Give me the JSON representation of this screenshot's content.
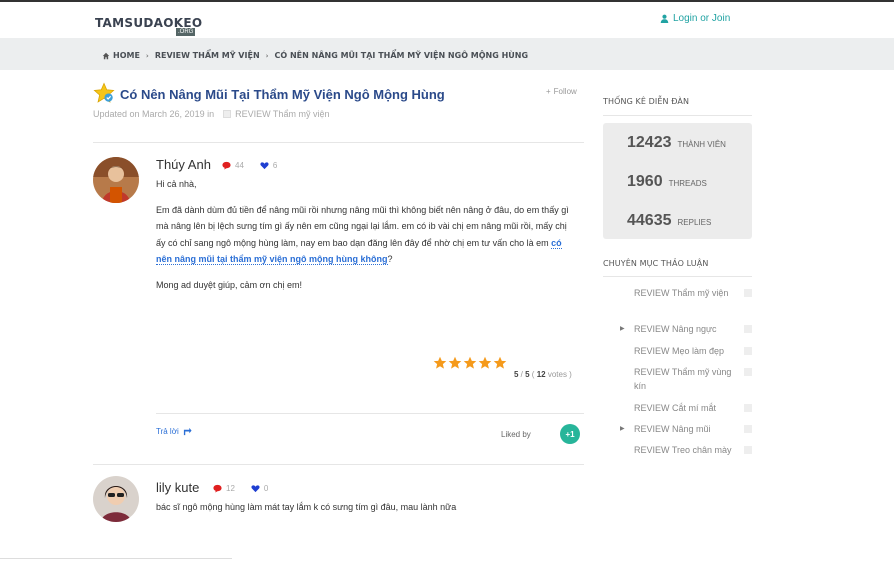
{
  "header": {
    "logo": "TAMSUDAOKEO",
    "logo_sub": ".ORG",
    "login": "Login or Join",
    "accent_color": "#21a3a3"
  },
  "breadcrumb": {
    "items": [
      "HOME",
      "REVIEW THẨM MỸ VIỆN",
      "CÓ NÊN NÂNG MŨI TẠI THẨM MỸ VIỆN NGÔ MỘNG HÙNG"
    ],
    "separator": "›"
  },
  "thread": {
    "title": "Có Nên Nâng Mũi Tại Thẩm Mỹ Viện Ngô Mộng Hùng",
    "follow": "Follow",
    "updated": "Updated on March 26, 2019 in",
    "category": "REVIEW Thẩm mỹ viện"
  },
  "posts": [
    {
      "author": "Thúy Anh",
      "comments": "44",
      "likes": "6",
      "paragraphs": {
        "p1": "Hi cả nhà,",
        "p2_before": "Em đã dành dùm đủ tiền để nâng mũi rồi nhưng nâng mũi thì không biết nên nâng ở đâu, do em thấy gì mà nâng lên bị lệch sưng tím gì ấy nên em cũng ngại lại lắm. em có ib vài chị em nâng mũi rồi, mấy chị ấy có chỉ sang ngô mộng hùng làm, nay em bao dạn đăng lên đây để nhờ chị em tư vấn cho là em ",
        "p2_link": "có nên nâng mũi tại thẩm mỹ viện ngô mộng hùng không",
        "p2_after": "?",
        "p3": "Mong ad duyệt giúp, cảm ơn chị em!"
      },
      "rating": {
        "stars": 5,
        "score": "5",
        "max": "5",
        "votes": "12",
        "votes_label": "votes"
      },
      "reply_label": "Trả lời",
      "liked_by": "Liked by",
      "plus_one": "+1"
    },
    {
      "author": "lily kute",
      "comments": "12",
      "likes": "0",
      "text": "bác sĩ ngô mộng hùng làm mát tay lắm k có sưng tím gì đâu, mau lành nữa"
    }
  ],
  "sidebar": {
    "stats_heading": "THỐNG KÊ DIỄN ĐÀN",
    "stats": [
      {
        "value": "12423",
        "label": "THÀNH VIÊN"
      },
      {
        "value": "1960",
        "label": "THREADS"
      },
      {
        "value": "44635",
        "label": "REPLIES"
      }
    ],
    "categories_heading": "CHUYÊN MỤC THẢO LUẬN",
    "categories": [
      {
        "label": "REVIEW Thẩm mỹ viện",
        "arrow": false
      },
      {
        "label": "REVIEW Nâng ngực",
        "arrow": true
      },
      {
        "label": "REVIEW Mẹo làm đẹp",
        "arrow": false
      },
      {
        "label": "REVIEW Thẩm mỹ vùng kín",
        "arrow": false
      },
      {
        "label": "REVIEW Cắt mí mắt",
        "arrow": false
      },
      {
        "label": "REVIEW Nâng mũi",
        "arrow": true
      },
      {
        "label": "REVIEW Treo chân mày",
        "arrow": false
      }
    ]
  },
  "colors": {
    "link_blue": "#2b6fd6",
    "title_blue": "#2b4a8a",
    "star_orange": "#f59a1b",
    "plus_green": "#27b59a",
    "comment_red": "#e02020",
    "heart_blue": "#1f3fd1"
  }
}
